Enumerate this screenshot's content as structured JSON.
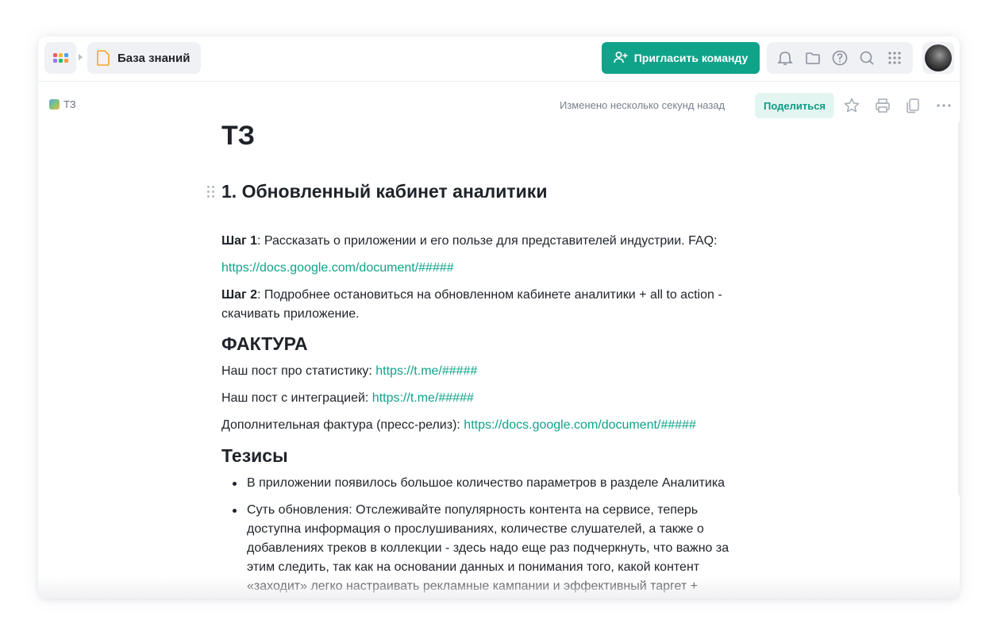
{
  "header": {
    "breadcrumb_root": "База знаний",
    "invite_label": "Пригласить команду",
    "icons": [
      "bell-icon",
      "folder-icon",
      "help-icon",
      "search-icon",
      "apps-icon"
    ],
    "accent_color": "#0fa38a"
  },
  "doc_bar": {
    "crumb": "ТЗ",
    "modified": "Изменено несколько секунд назад",
    "share_label": "Поделиться"
  },
  "doc": {
    "title": "ТЗ",
    "h1": "1. Обновленный кабинет аналитики",
    "step1_label": "Шаг 1",
    "step1_text": ": Рассказать о приложении и его пользе для представителей индустрии. FAQ:",
    "step1_link": "https://docs.google.com/document/#####",
    "step2_label": "Шаг 2",
    "step2_text": ": Подробнее остановиться на обновленном кабинете аналитики + all to action - скачивать приложение.",
    "section_facts": "ФАКТУРА",
    "fact1_text": "Наш пост про статистику: ",
    "fact1_link": "https://t.me/#####",
    "fact2_text": "Наш пост с интеграцией: ",
    "fact2_link": "https://t.me/#####",
    "fact3_text": "Дополнительная фактура (пресс-релиз): ",
    "fact3_link": "https://docs.google.com/document/#####",
    "section_theses": "Тезисы",
    "bullets": [
      "В приложении появилось большое количество параметров в разделе Аналитика",
      "Суть обновления: Отслеживайте популярность контента на сервисе, теперь доступна информация о прослушиваниях, количестве слушателей, а также о добавлениях треков в коллекции - здесь надо еще раз подчеркнуть, что важно за этим следить, так как на основании данных и понимания того, какой контент «заходит» легко настраивать рекламные кампании и эффективный таргет +"
    ]
  }
}
